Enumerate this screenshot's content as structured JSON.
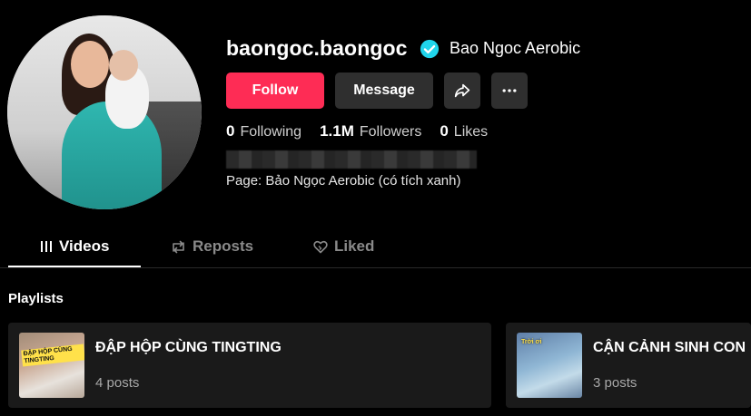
{
  "profile": {
    "username": "baongoc.baongoc",
    "nickname": "Bao Ngoc Aerobic",
    "verified_badge_icon": "verified-check-icon",
    "bio": "Page: Bảo Ngọc Aerobic (có tích xanh)"
  },
  "actions": {
    "follow_label": "Follow",
    "message_label": "Message",
    "share_icon": "share-arrow-icon",
    "more_icon": "more-dots-icon"
  },
  "stats": {
    "following_count": "0",
    "following_label": "Following",
    "followers_count": "1.1M",
    "followers_label": "Followers",
    "likes_count": "0",
    "likes_label": "Likes"
  },
  "tabs": [
    {
      "label": "Videos",
      "icon": "grid-lines-icon",
      "active": true
    },
    {
      "label": "Reposts",
      "icon": "repost-icon",
      "active": false
    },
    {
      "label": "Liked",
      "icon": "heart-outline-icon",
      "active": false
    }
  ],
  "playlists": {
    "title": "Playlists",
    "items": [
      {
        "title": "ĐẬP HỘP CÙNG TINGTING",
        "count": "4 posts",
        "thumb_text": "ĐẬP HỘP CÙNG TINGTING"
      },
      {
        "title": "CẬN CẢNH SINH CON",
        "count": "3 posts",
        "thumb_text": "Trời ơi"
      }
    ]
  },
  "colors": {
    "accent": "#fe2c55",
    "verified": "#20d5ec",
    "button_secondary": "#2f2f2f",
    "background": "#000000"
  }
}
